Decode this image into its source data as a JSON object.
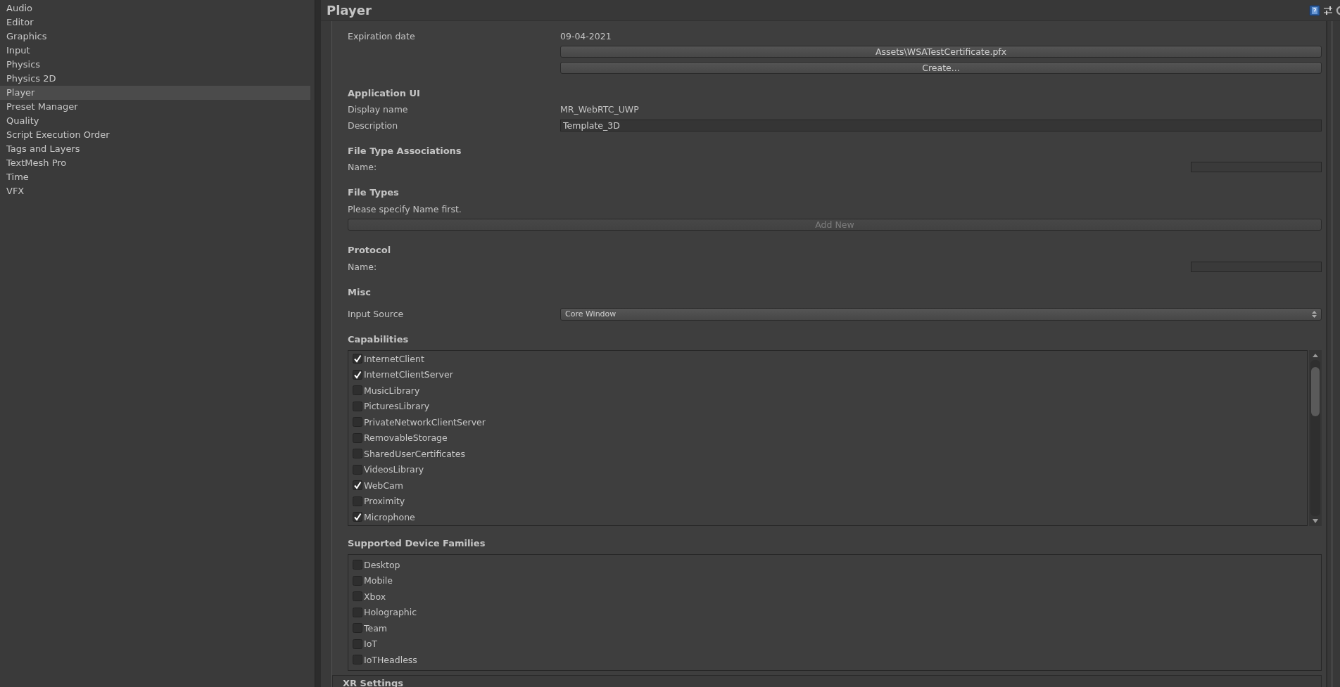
{
  "sidebar": {
    "items": [
      {
        "label": "Audio",
        "selected": false
      },
      {
        "label": "Editor",
        "selected": false
      },
      {
        "label": "Graphics",
        "selected": false
      },
      {
        "label": "Input",
        "selected": false
      },
      {
        "label": "Physics",
        "selected": false
      },
      {
        "label": "Physics 2D",
        "selected": false
      },
      {
        "label": "Player",
        "selected": true
      },
      {
        "label": "Preset Manager",
        "selected": false
      },
      {
        "label": "Quality",
        "selected": false
      },
      {
        "label": "Script Execution Order",
        "selected": false
      },
      {
        "label": "Tags and Layers",
        "selected": false
      },
      {
        "label": "TextMesh Pro",
        "selected": false
      },
      {
        "label": "Time",
        "selected": false
      },
      {
        "label": "VFX",
        "selected": false
      }
    ]
  },
  "inspector": {
    "title": "Player",
    "rows": [
      {
        "kind": "pair",
        "label": "Expiration date",
        "value": "09-04-2021"
      },
      {
        "kind": "button",
        "label": "Assets\\WSATestCertificate.pfx",
        "disabled": false
      },
      {
        "kind": "button",
        "label": "Create...",
        "disabled": false
      },
      {
        "kind": "heading",
        "label": "Application UI"
      },
      {
        "kind": "pair",
        "label": "Display name",
        "value": "MR_WebRTC_UWP"
      },
      {
        "kind": "field",
        "label": "Description",
        "value": "Template_3D"
      },
      {
        "kind": "heading",
        "label": "File Type Associations"
      },
      {
        "kind": "small_field",
        "label": "Name:"
      },
      {
        "kind": "heading",
        "label": "File Types"
      },
      {
        "kind": "note",
        "label": "Please specify Name first."
      },
      {
        "kind": "wide_button",
        "label": "Add New",
        "disabled": true
      },
      {
        "kind": "heading",
        "label": "Protocol"
      },
      {
        "kind": "small_field",
        "label": "Name:"
      },
      {
        "kind": "heading",
        "label": "Misc"
      },
      {
        "kind": "dropdown",
        "label": "Input Source",
        "value": "Core Window"
      },
      {
        "kind": "heading",
        "label": "Capabilities"
      },
      {
        "kind": "checklist",
        "scrollable": true,
        "items": [
          {
            "label": "InternetClient",
            "checked": true
          },
          {
            "label": "InternetClientServer",
            "checked": true
          },
          {
            "label": "MusicLibrary",
            "checked": false
          },
          {
            "label": "PicturesLibrary",
            "checked": false
          },
          {
            "label": "PrivateNetworkClientServer",
            "checked": false
          },
          {
            "label": "RemovableStorage",
            "checked": false
          },
          {
            "label": "SharedUserCertificates",
            "checked": false
          },
          {
            "label": "VideosLibrary",
            "checked": false
          },
          {
            "label": "WebCam",
            "checked": true
          },
          {
            "label": "Proximity",
            "checked": false
          },
          {
            "label": "Microphone",
            "checked": true
          }
        ]
      },
      {
        "kind": "heading",
        "label": "Supported Device Families"
      },
      {
        "kind": "checklist",
        "scrollable": false,
        "items": [
          {
            "label": "Desktop",
            "checked": false
          },
          {
            "label": "Mobile",
            "checked": false
          },
          {
            "label": "Xbox",
            "checked": false
          },
          {
            "label": "Holographic",
            "checked": false
          },
          {
            "label": "Team",
            "checked": false
          },
          {
            "label": "IoT",
            "checked": false
          },
          {
            "label": "IoTHeadless",
            "checked": false
          }
        ]
      },
      {
        "kind": "foldout",
        "label": "XR Settings"
      }
    ]
  }
}
